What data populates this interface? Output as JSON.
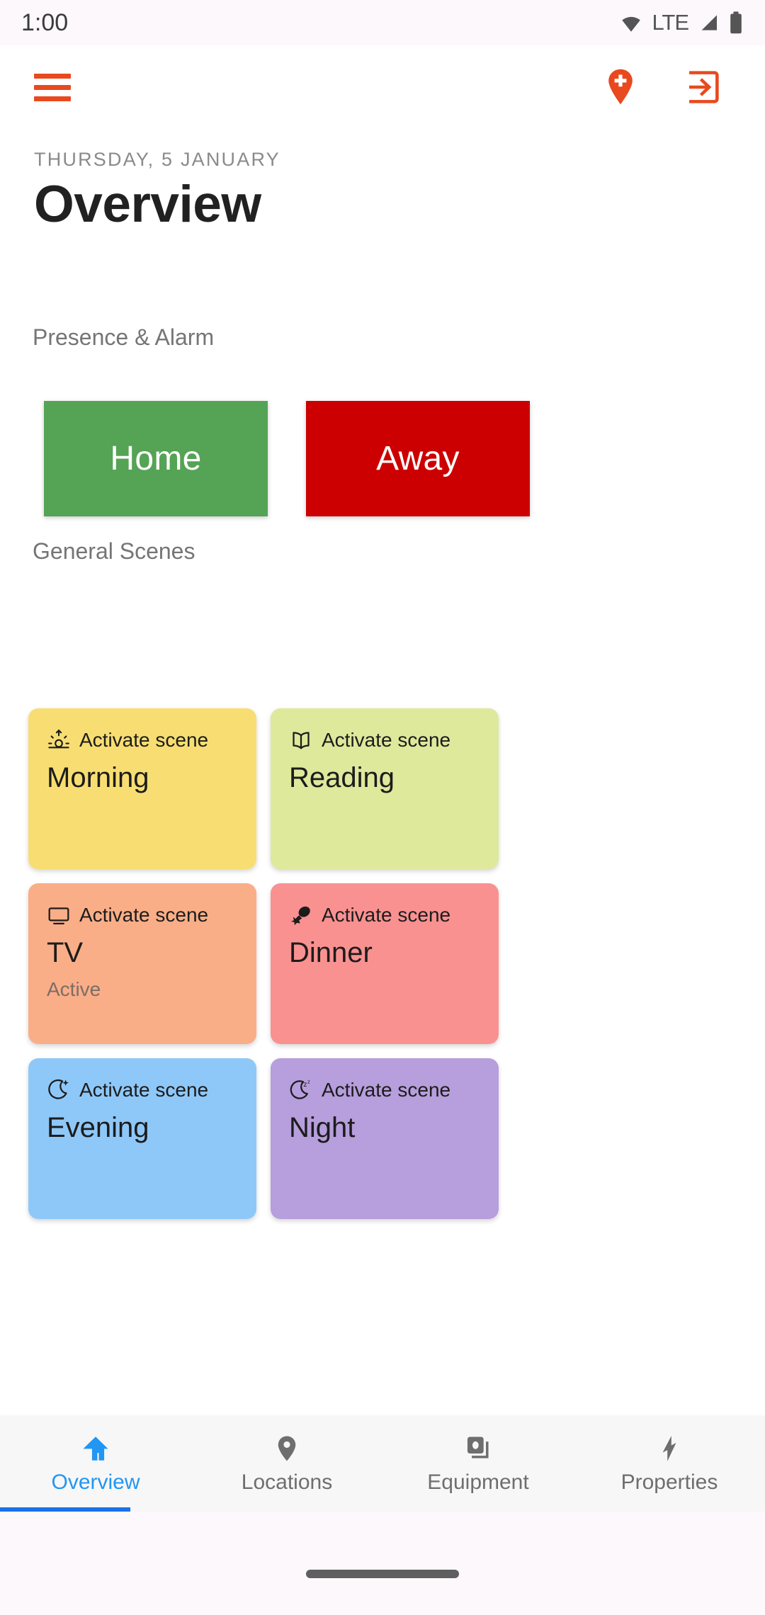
{
  "status_bar": {
    "time": "1:00",
    "network_label": "LTE",
    "icons": [
      "wifi-icon",
      "signal-icon",
      "battery-icon"
    ]
  },
  "app_bar": {
    "menu_icon": "hamburger-menu-icon",
    "actions": [
      {
        "name": "add-location-icon",
        "icon": "map-pin-plus-icon"
      },
      {
        "name": "logout-icon",
        "icon": "exit-arrow-icon"
      }
    ]
  },
  "header": {
    "date": "THURSDAY, 5 JANUARY",
    "title": "Overview"
  },
  "presence": {
    "section_label": "Presence & Alarm",
    "buttons": [
      {
        "label": "Home",
        "color": "#55A355"
      },
      {
        "label": "Away",
        "color": "#CC0000"
      }
    ]
  },
  "scenes": {
    "section_label": "General Scenes",
    "activate_label": "Activate scene",
    "items": [
      {
        "name": "Morning",
        "icon": "sunrise-icon",
        "color": "#F8DE72",
        "status": ""
      },
      {
        "name": "Reading",
        "icon": "book-icon",
        "color": "#DEE99C",
        "status": ""
      },
      {
        "name": "TV",
        "icon": "television-icon",
        "color": "#FAAE87",
        "status": "Active"
      },
      {
        "name": "Dinner",
        "icon": "drumstick-icon",
        "color": "#FA9191",
        "status": ""
      },
      {
        "name": "Evening",
        "icon": "moon-star-icon",
        "color": "#8EC8F8",
        "status": ""
      },
      {
        "name": "Night",
        "icon": "moon-zzz-icon",
        "color": "#B79EDC",
        "status": ""
      }
    ]
  },
  "bottom_nav": {
    "active_color": "#2196F3",
    "items": [
      {
        "label": "Overview",
        "icon": "home-icon",
        "active": true
      },
      {
        "label": "Locations",
        "icon": "map-pin-icon",
        "active": false
      },
      {
        "label": "Equipment",
        "icon": "devices-icon",
        "active": false
      },
      {
        "label": "Properties",
        "icon": "lightning-icon",
        "active": false
      }
    ]
  },
  "accent_color": "#E8491E"
}
